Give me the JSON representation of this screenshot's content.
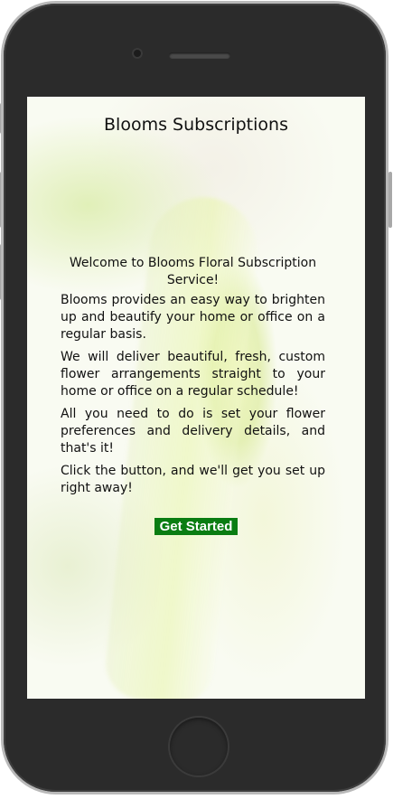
{
  "header": {
    "title": "Blooms Subscriptions"
  },
  "main": {
    "welcome_heading": "Welcome to Blooms Floral Subscription Service!",
    "paragraphs": [
      "Blooms provides an easy way to brighten up and beautify your home or office on a regular basis.",
      "We will deliver beautiful, fresh, custom flower arrangements straight to your home or office on a regular schedule!",
      "All you need to do is set your flower preferences and delivery details, and that's it!",
      "Click the button, and we'll get you set up right away!"
    ],
    "cta_label": "Get Started"
  },
  "colors": {
    "cta_background": "#0a7d12",
    "phone_frame": "#2b2b2b"
  }
}
